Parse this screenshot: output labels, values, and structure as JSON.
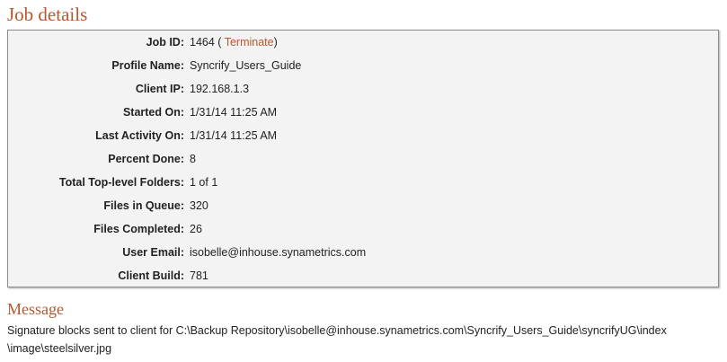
{
  "job_details": {
    "title": "Job details",
    "rows": [
      {
        "label": "Job ID:",
        "value": "1464"
      },
      {
        "label": "Profile Name:",
        "value": "Syncrify_Users_Guide"
      },
      {
        "label": "Client IP:",
        "value": "192.168.1.3"
      },
      {
        "label": "Started On:",
        "value": "1/31/14 11:25 AM"
      },
      {
        "label": "Last Activity On:",
        "value": "1/31/14 11:25 AM"
      },
      {
        "label": "Percent Done:",
        "value": "8"
      },
      {
        "label": "Total Top-level Folders:",
        "value": "1 of 1"
      },
      {
        "label": "Files in Queue:",
        "value": "320"
      },
      {
        "label": "Files Completed:",
        "value": "26"
      },
      {
        "label": "User Email:",
        "value": "isobelle@inhouse.synametrics.com"
      },
      {
        "label": "Client Build:",
        "value": "781"
      }
    ],
    "terminate_open": " ( ",
    "terminate_label": "Terminate",
    "terminate_close": ")"
  },
  "message": {
    "title": "Message",
    "line1": "Signature blocks sent to client for C:\\Backup Repository\\isobelle@inhouse.synametrics.com\\Syncrify_Users_Guide\\syncrifyUG\\index",
    "line2": "\\image\\steelsilver.jpg"
  },
  "colors": {
    "accent": "#b5572f",
    "box_background": "#f3f3f3",
    "box_border": "#8d8d8d",
    "text": "#222222"
  }
}
